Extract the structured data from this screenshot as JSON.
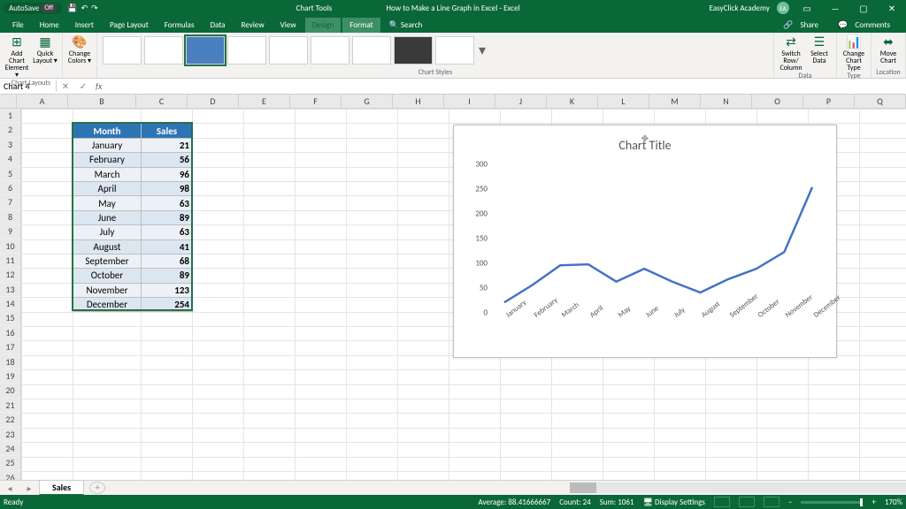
{
  "titlebar": {
    "autosave_label": "AutoSave",
    "autosave_state": "Off",
    "chart_tools_label": "Chart Tools",
    "doc_title": "How to Make a Line Graph in Excel - Excel",
    "account": "EasyClick Academy",
    "account_initials": "EA"
  },
  "tabs": {
    "file": "File",
    "home": "Home",
    "insert": "Insert",
    "pagelayout": "Page Layout",
    "formulas": "Formulas",
    "data": "Data",
    "review": "Review",
    "view": "View",
    "design": "Design",
    "format": "Format",
    "search": "Search",
    "share": "Share",
    "comments": "Comments"
  },
  "ribbon": {
    "add_chart_element": "Add Chart Element ▾",
    "quick_layout": "Quick Layout ▾",
    "change_colors": "Change Colors ▾",
    "switch_row_col": "Switch Row/ Column",
    "select_data": "Select Data",
    "change_chart_type": "Change Chart Type",
    "move_chart": "Move Chart",
    "group_chart_layouts": "Chart Layouts",
    "group_chart_styles": "Chart Styles",
    "group_data": "Data",
    "group_type": "Type",
    "group_location": "Location"
  },
  "namebox": "Chart 4",
  "fx_label": "fx",
  "columns": [
    "A",
    "B",
    "C",
    "D",
    "E",
    "F",
    "G",
    "H",
    "I",
    "J",
    "K",
    "L",
    "M",
    "N",
    "O",
    "P",
    "Q"
  ],
  "table": {
    "headers": [
      "Month",
      "Sales"
    ],
    "rows": [
      [
        "January",
        21
      ],
      [
        "February",
        56
      ],
      [
        "March",
        96
      ],
      [
        "April",
        98
      ],
      [
        "May",
        63
      ],
      [
        "June",
        89
      ],
      [
        "July",
        63
      ],
      [
        "August",
        41
      ],
      [
        "September",
        68
      ],
      [
        "October",
        89
      ],
      [
        "November",
        123
      ],
      [
        "December",
        254
      ]
    ]
  },
  "chart_data": {
    "type": "line",
    "title": "Chart Title",
    "categories": [
      "January",
      "February",
      "March",
      "April",
      "May",
      "June",
      "July",
      "August",
      "September",
      "October",
      "November",
      "December"
    ],
    "values": [
      21,
      56,
      96,
      98,
      63,
      89,
      63,
      41,
      68,
      89,
      123,
      254
    ],
    "ylim": [
      0,
      300
    ],
    "yticks": [
      0,
      50,
      100,
      150,
      200,
      250,
      300
    ],
    "xlabel": "",
    "ylabel": ""
  },
  "sheettab": "Sales",
  "statusbar": {
    "ready": "Ready",
    "average_label": "Average:",
    "average": "88.41666667",
    "count_label": "Count:",
    "count": "24",
    "sum_label": "Sum:",
    "sum": "1061",
    "display_settings": "Display Settings",
    "zoom": "170%"
  }
}
